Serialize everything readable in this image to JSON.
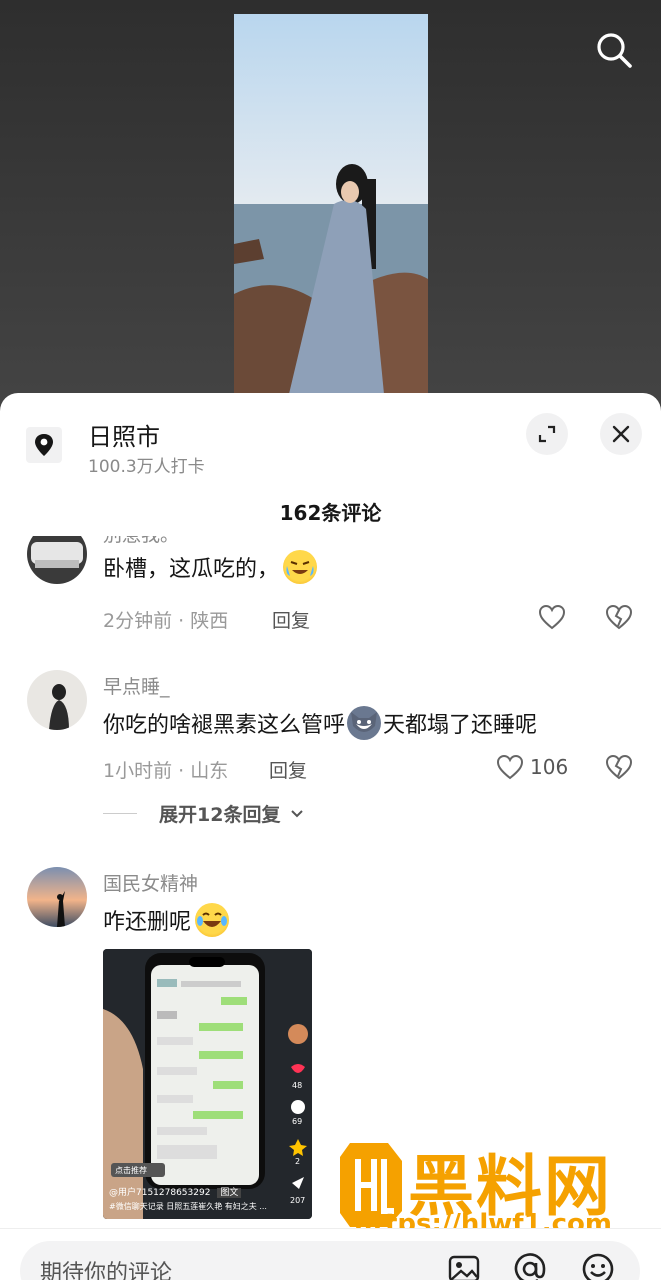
{
  "location": {
    "title": "日照市",
    "subtitle": "100.3万人打卡"
  },
  "comments_header": "162条评论",
  "comments": [
    {
      "user": "别惹我。",
      "text": "卧槽，这瓜吃的，",
      "emoji": "crying-laughing-emoji",
      "time_location": "2分钟前 · 陕西",
      "reply_label": "回复",
      "likes": ""
    },
    {
      "user": "早点睡_",
      "text_before": "你吃的啥褪黑素这么管呼",
      "emoji": "wolf-emoji",
      "text_after": "天都塌了还睡呢",
      "time_location": "1小时前 · 山东",
      "reply_label": "回复",
      "likes": "106",
      "expand_replies": "展开12条回复"
    },
    {
      "user": "国民女精神",
      "text": "咋还删呢",
      "emoji": "tears-of-joy-emoji",
      "attached_image": {
        "caption_user": "@用户7151278653292",
        "caption_tag": "图文",
        "caption_text": "#微信聊天记录 日照五莲崔久艳 有妇之夫 ...",
        "promo_label": "点击推荐",
        "side_counts": [
          "48",
          "69",
          "2",
          "207"
        ]
      }
    }
  ],
  "watermark": {
    "brand": "黑料网",
    "url": "https://hlwf1.com"
  },
  "input": {
    "placeholder": "期待你的评论"
  },
  "colors": {
    "sheet_bg": "#ffffff",
    "primary_text": "#161616",
    "secondary_text": "#8b8b8b",
    "watermark_orange": "#f5a100"
  }
}
